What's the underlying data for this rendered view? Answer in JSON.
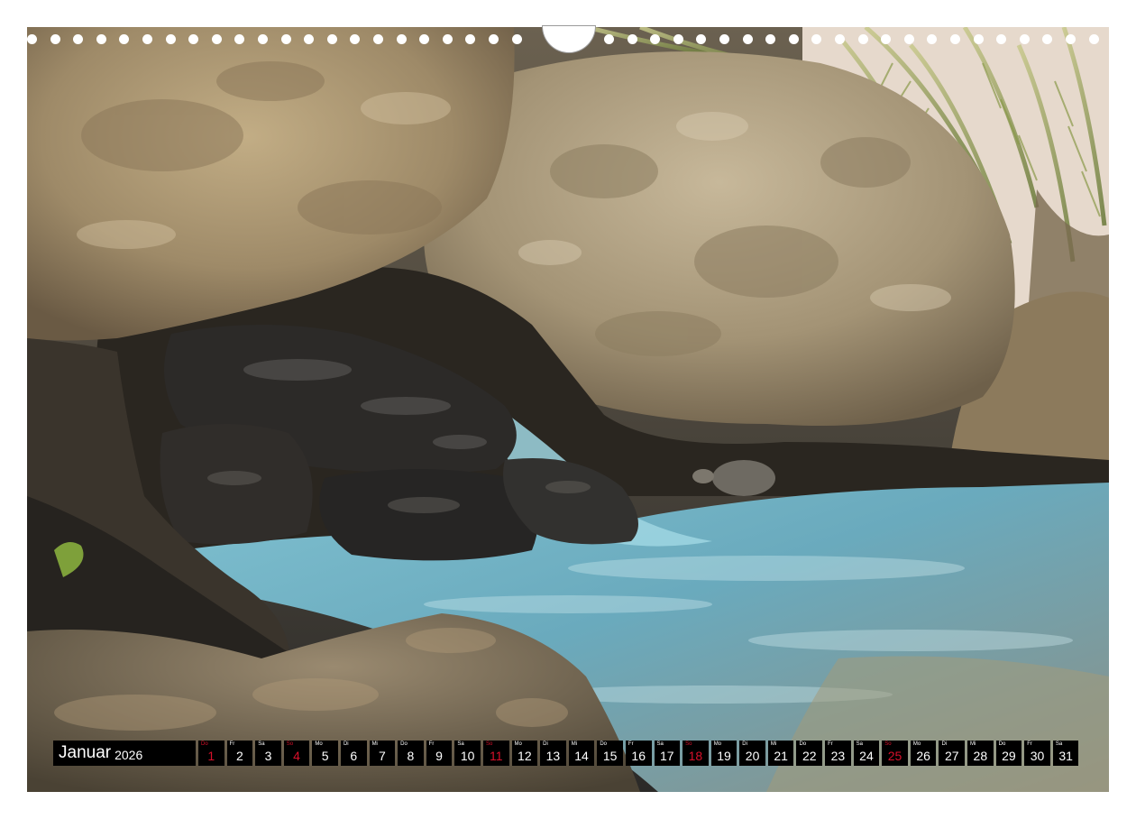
{
  "calendar": {
    "month": "Januar",
    "year": "2026",
    "holiday_color": "#d8102a",
    "days": [
      {
        "weekday": "Do",
        "day": "1",
        "red": true
      },
      {
        "weekday": "Fr",
        "day": "2",
        "red": false
      },
      {
        "weekday": "Sa",
        "day": "3",
        "red": false
      },
      {
        "weekday": "So",
        "day": "4",
        "red": true
      },
      {
        "weekday": "Mo",
        "day": "5",
        "red": false
      },
      {
        "weekday": "Di",
        "day": "6",
        "red": false
      },
      {
        "weekday": "Mi",
        "day": "7",
        "red": false
      },
      {
        "weekday": "Do",
        "day": "8",
        "red": false
      },
      {
        "weekday": "Fr",
        "day": "9",
        "red": false
      },
      {
        "weekday": "Sa",
        "day": "10",
        "red": false
      },
      {
        "weekday": "So",
        "day": "11",
        "red": true
      },
      {
        "weekday": "Mo",
        "day": "12",
        "red": false
      },
      {
        "weekday": "Di",
        "day": "13",
        "red": false
      },
      {
        "weekday": "Mi",
        "day": "14",
        "red": false
      },
      {
        "weekday": "Do",
        "day": "15",
        "red": false
      },
      {
        "weekday": "Fr",
        "day": "16",
        "red": false
      },
      {
        "weekday": "Sa",
        "day": "17",
        "red": false
      },
      {
        "weekday": "So",
        "day": "18",
        "red": true
      },
      {
        "weekday": "Mo",
        "day": "19",
        "red": false
      },
      {
        "weekday": "Di",
        "day": "20",
        "red": false
      },
      {
        "weekday": "Mi",
        "day": "21",
        "red": false
      },
      {
        "weekday": "Do",
        "day": "22",
        "red": false
      },
      {
        "weekday": "Fr",
        "day": "23",
        "red": false
      },
      {
        "weekday": "Sa",
        "day": "24",
        "red": false
      },
      {
        "weekday": "So",
        "day": "25",
        "red": true
      },
      {
        "weekday": "Mo",
        "day": "26",
        "red": false
      },
      {
        "weekday": "Di",
        "day": "27",
        "red": false
      },
      {
        "weekday": "Mi",
        "day": "28",
        "red": false
      },
      {
        "weekday": "Do",
        "day": "29",
        "red": false
      },
      {
        "weekday": "Fr",
        "day": "30",
        "red": false
      },
      {
        "weekday": "Sa",
        "day": "31",
        "red": false
      }
    ]
  }
}
